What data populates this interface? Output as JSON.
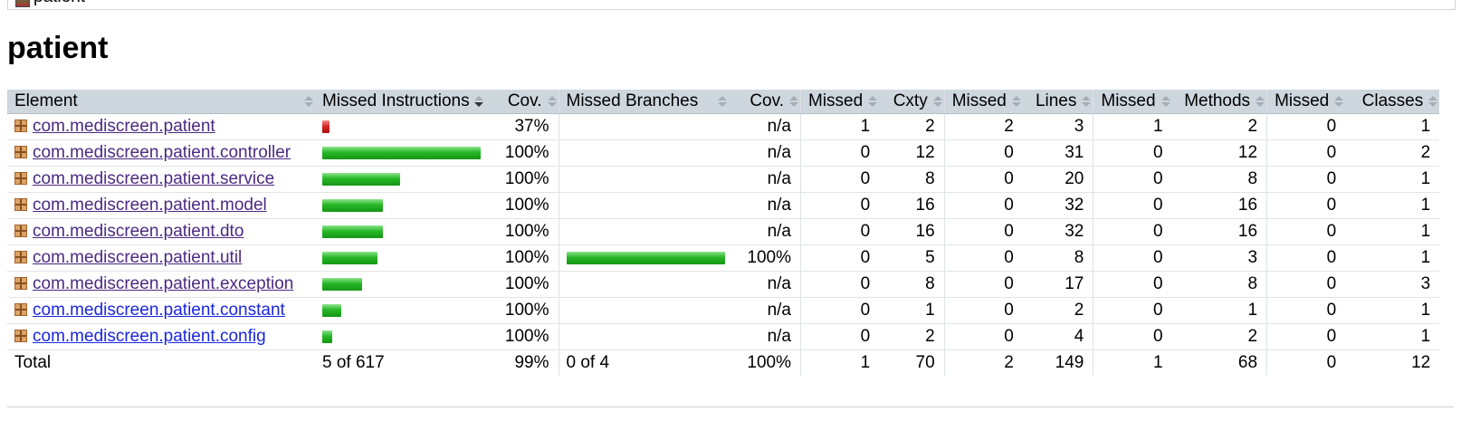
{
  "breadcrumb": {
    "label": "patient"
  },
  "page": {
    "title": "patient"
  },
  "table": {
    "headers": [
      "Element",
      "Missed Instructions",
      "Cov.",
      "Missed Branches",
      "Cov.",
      "Missed",
      "Cxty",
      "Missed",
      "Lines",
      "Missed",
      "Methods",
      "Missed",
      "Classes"
    ],
    "rows": [
      {
        "name": "com.mediscreen.patient",
        "instr_missed_pct": 63,
        "instr_covered_pct": 37,
        "instr_cov": "37%",
        "branch_cov_pct": null,
        "branch_cov": "n/a",
        "missed_cxty": "1",
        "cxty": "2",
        "missed_lines": "2",
        "lines": "3",
        "missed_methods": "1",
        "methods": "2",
        "missed_classes": "0",
        "classes": "1",
        "visited": true
      },
      {
        "name": "com.mediscreen.patient.controller",
        "instr_missed_pct": 0,
        "instr_covered_pct": 100,
        "instr_cov": "100%",
        "branch_cov_pct": null,
        "branch_cov": "n/a",
        "missed_cxty": "0",
        "cxty": "12",
        "missed_lines": "0",
        "lines": "31",
        "missed_methods": "0",
        "methods": "12",
        "missed_classes": "0",
        "classes": "2",
        "visited": true
      },
      {
        "name": "com.mediscreen.patient.service",
        "instr_missed_pct": 0,
        "instr_covered_pct": 100,
        "instr_cov": "100%",
        "branch_cov_pct": null,
        "branch_cov": "n/a",
        "missed_cxty": "0",
        "cxty": "8",
        "missed_lines": "0",
        "lines": "20",
        "missed_methods": "0",
        "methods": "8",
        "missed_classes": "0",
        "classes": "1",
        "visited": true
      },
      {
        "name": "com.mediscreen.patient.model",
        "instr_missed_pct": 0,
        "instr_covered_pct": 100,
        "instr_cov": "100%",
        "branch_cov_pct": null,
        "branch_cov": "n/a",
        "missed_cxty": "0",
        "cxty": "16",
        "missed_lines": "0",
        "lines": "32",
        "missed_methods": "0",
        "methods": "16",
        "missed_classes": "0",
        "classes": "1",
        "visited": true
      },
      {
        "name": "com.mediscreen.patient.dto",
        "instr_missed_pct": 0,
        "instr_covered_pct": 100,
        "instr_cov": "100%",
        "branch_cov_pct": null,
        "branch_cov": "n/a",
        "missed_cxty": "0",
        "cxty": "16",
        "missed_lines": "0",
        "lines": "32",
        "missed_methods": "0",
        "methods": "16",
        "missed_classes": "0",
        "classes": "1",
        "visited": true
      },
      {
        "name": "com.mediscreen.patient.util",
        "instr_missed_pct": 0,
        "instr_covered_pct": 100,
        "instr_cov": "100%",
        "branch_cov_pct": 100,
        "branch_cov": "100%",
        "missed_cxty": "0",
        "cxty": "5",
        "missed_lines": "0",
        "lines": "8",
        "missed_methods": "0",
        "methods": "3",
        "missed_classes": "0",
        "classes": "1",
        "visited": true
      },
      {
        "name": "com.mediscreen.patient.exception",
        "instr_missed_pct": 0,
        "instr_covered_pct": 100,
        "instr_cov": "100%",
        "branch_cov_pct": null,
        "branch_cov": "n/a",
        "missed_cxty": "0",
        "cxty": "8",
        "missed_lines": "0",
        "lines": "17",
        "missed_methods": "0",
        "methods": "8",
        "missed_classes": "0",
        "classes": "3",
        "visited": true
      },
      {
        "name": "com.mediscreen.patient.constant",
        "instr_missed_pct": 0,
        "instr_covered_pct": 100,
        "instr_cov": "100%",
        "branch_cov_pct": null,
        "branch_cov": "n/a",
        "missed_cxty": "0",
        "cxty": "1",
        "missed_lines": "0",
        "lines": "2",
        "missed_methods": "0",
        "methods": "1",
        "missed_classes": "0",
        "classes": "1",
        "visited": false
      },
      {
        "name": "com.mediscreen.patient.config",
        "instr_missed_pct": 0,
        "instr_covered_pct": 100,
        "instr_cov": "100%",
        "branch_cov_pct": null,
        "branch_cov": "n/a",
        "missed_cxty": "0",
        "cxty": "2",
        "missed_lines": "0",
        "lines": "4",
        "missed_methods": "0",
        "methods": "2",
        "missed_classes": "0",
        "classes": "1",
        "visited": false
      }
    ],
    "instr_bar_scale": [
      2,
      100,
      49,
      38,
      38,
      35,
      25,
      12,
      6
    ],
    "branch_bar_scale": [
      0,
      0,
      0,
      0,
      0,
      100,
      0,
      0,
      0
    ],
    "total": {
      "label": "Total",
      "instr": "5 of 617",
      "instr_cov": "99%",
      "branches": "0 of 4",
      "branch_cov": "100%",
      "missed_cxty": "1",
      "cxty": "70",
      "missed_lines": "2",
      "lines": "149",
      "missed_methods": "1",
      "methods": "68",
      "missed_classes": "0",
      "classes": "12"
    }
  },
  "colors": {
    "covered": "#2bb52b",
    "missed": "#d42222",
    "header_bg": "#ced6de"
  }
}
